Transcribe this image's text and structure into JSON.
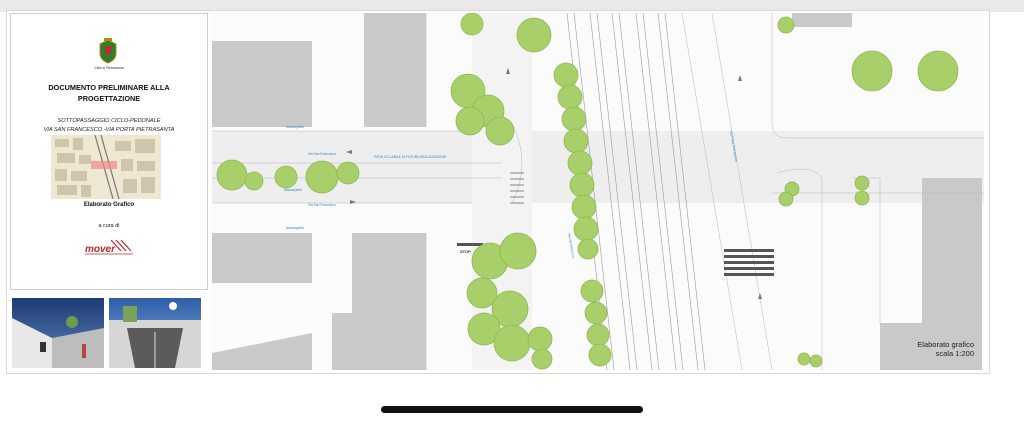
{
  "document": {
    "municipality_label": "Città di Pietrasanta",
    "title_line1": "DOCUMENTO PRELIMINARE ALLA",
    "title_line2": "PROGETTAZIONE",
    "subtitle_line1": "SOTTOPASSAGGIO CICLO-PEDONALE",
    "subtitle_line2": "VIA SAN FRANCESCO -VIA PORTA PIETRASANTA",
    "elaborato": "Elaborato Grafico",
    "cura": "a cura di",
    "logo_text": "mover"
  },
  "plan": {
    "scale_title": "Elaborato grafico",
    "scale_value": "scala 1:200",
    "stop_label": "STOP",
    "labels": {
      "marciapiede": "Marciapiede",
      "via_san_francesco": "Via San Francesco",
      "pista_ciclabile": "PISTA CICLABILE DI FUTURA REALIZZAZIONE",
      "via_del_marzocco": "Via Del Marzocco",
      "via_porta": "Via Porta Pietrasanta"
    }
  },
  "colors": {
    "tree": "#a9cf6b",
    "building": "#c9c9c9",
    "blue_label": "#3a7fc0",
    "logo_red": "#c0282d"
  }
}
